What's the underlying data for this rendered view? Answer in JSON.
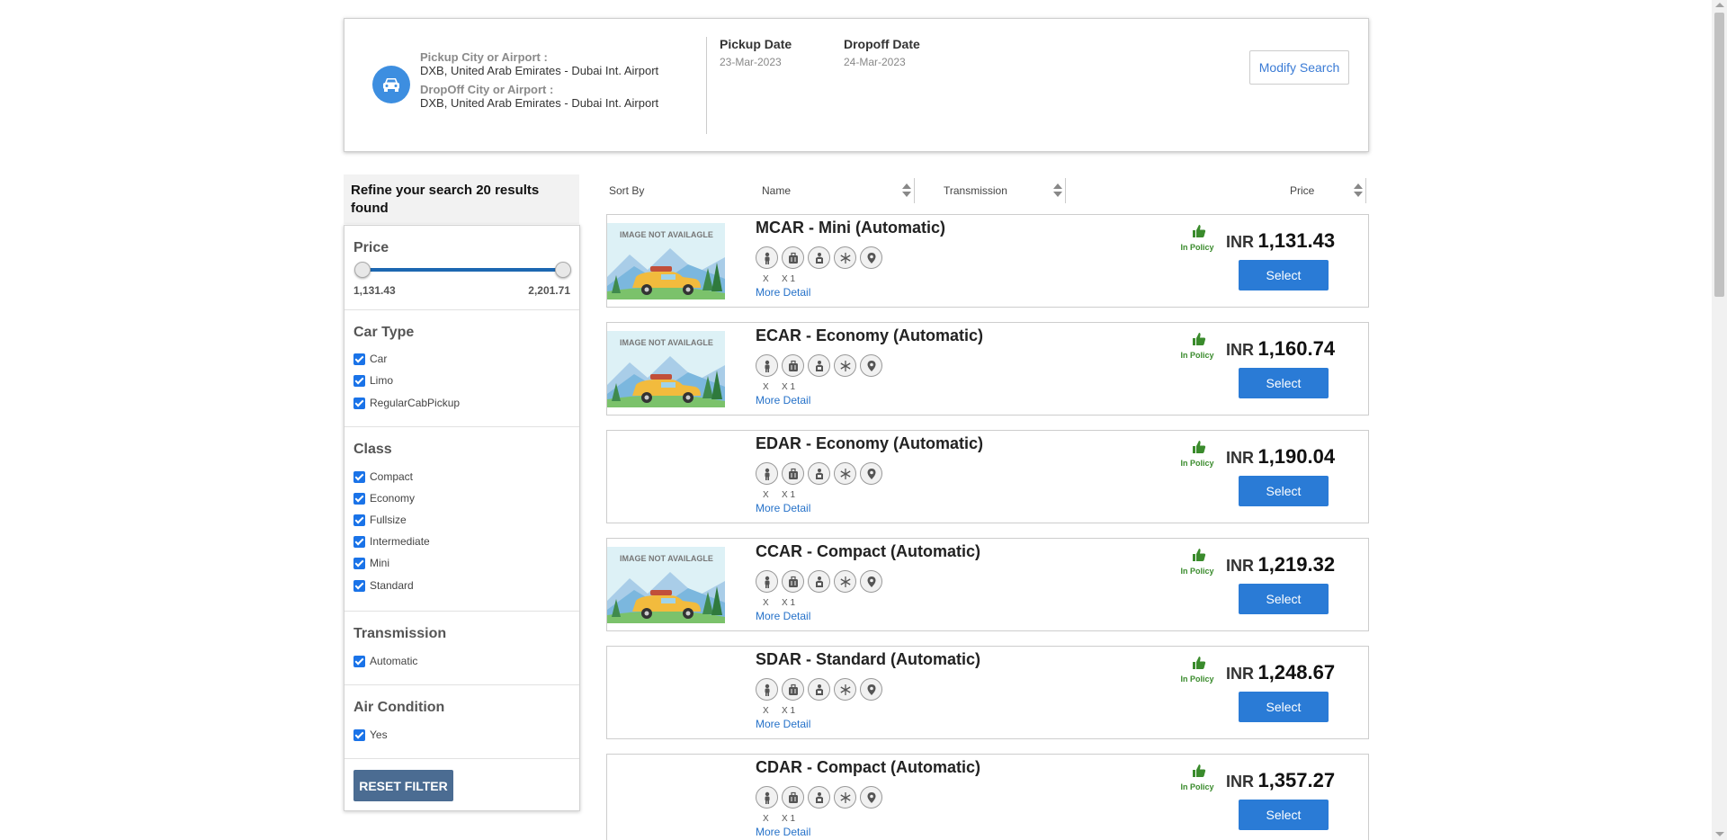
{
  "search": {
    "pickup_label": "Pickup City or Airport :",
    "pickup_value": "DXB, United Arab Emirates - Dubai Int. Airport",
    "dropoff_label": "DropOff City or Airport :",
    "dropoff_value": "DXB, United Arab Emirates - Dubai Int. Airport",
    "pickup_date_label": "Pickup Date",
    "pickup_date": "23-Mar-2023",
    "dropoff_date_label": "Dropoff Date",
    "dropoff_date": "24-Mar-2023",
    "modify_label": "Modify Search"
  },
  "filters": {
    "heading": "Refine your search 20 results found",
    "price": {
      "title": "Price",
      "min": "1,131.43",
      "max": "2,201.71"
    },
    "car_type": {
      "title": "Car Type",
      "options": [
        "Car",
        "Limo",
        "RegularCabPickup"
      ]
    },
    "class": {
      "title": "Class",
      "options": [
        "Compact",
        "Economy",
        "Fullsize",
        "Intermediate",
        "Mini",
        "Standard"
      ]
    },
    "transmission": {
      "title": "Transmission",
      "options": [
        "Automatic"
      ]
    },
    "air_condition": {
      "title": "Air Condition",
      "options": [
        "Yes"
      ]
    },
    "reset_label": "RESET FILTER"
  },
  "sort": {
    "label": "Sort By",
    "name": "Name",
    "transmission": "Transmission",
    "price": "Price"
  },
  "common": {
    "image_na": "IMAGE NOT AVAILAGLE",
    "pax_label": "X",
    "bag_label": "X 1",
    "more_detail": "More Detail",
    "policy": "In Policy",
    "select": "Select",
    "currency": "INR"
  },
  "results": [
    {
      "name": "MCAR - Mini (Automatic)",
      "price": "1,131.43",
      "has_image": true
    },
    {
      "name": "ECAR - Economy (Automatic)",
      "price": "1,160.74",
      "has_image": true
    },
    {
      "name": "EDAR - Economy (Automatic)",
      "price": "1,190.04",
      "has_image": false
    },
    {
      "name": "CCAR - Compact (Automatic)",
      "price": "1,219.32",
      "has_image": true
    },
    {
      "name": "SDAR - Standard (Automatic)",
      "price": "1,248.67",
      "has_image": false
    },
    {
      "name": "CDAR - Compact (Automatic)",
      "price": "1,357.27",
      "has_image": false
    }
  ],
  "colors": {
    "accent": "#2a7bd6",
    "policy": "#3a8b2c",
    "reset": "#4b6c92",
    "slider": "#1c67b1"
  }
}
